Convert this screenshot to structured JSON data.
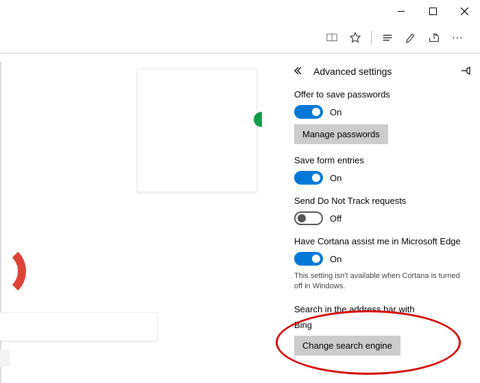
{
  "panel": {
    "title": "Advanced settings",
    "settings": {
      "save_passwords": {
        "label": "Offer to save passwords",
        "state_label": "On",
        "button": "Manage passwords"
      },
      "save_form": {
        "label": "Save form entries",
        "state_label": "On"
      },
      "dnt": {
        "label": "Send Do Not Track requests",
        "state_label": "Off"
      },
      "cortana": {
        "label": "Have Cortana assist me in Microsoft Edge",
        "state_label": "On",
        "note": "This setting isn't available when Cortana is turned off in Windows."
      },
      "search": {
        "label": "Search in the address bar with",
        "value": "Bing",
        "button": "Change search engine"
      }
    }
  }
}
